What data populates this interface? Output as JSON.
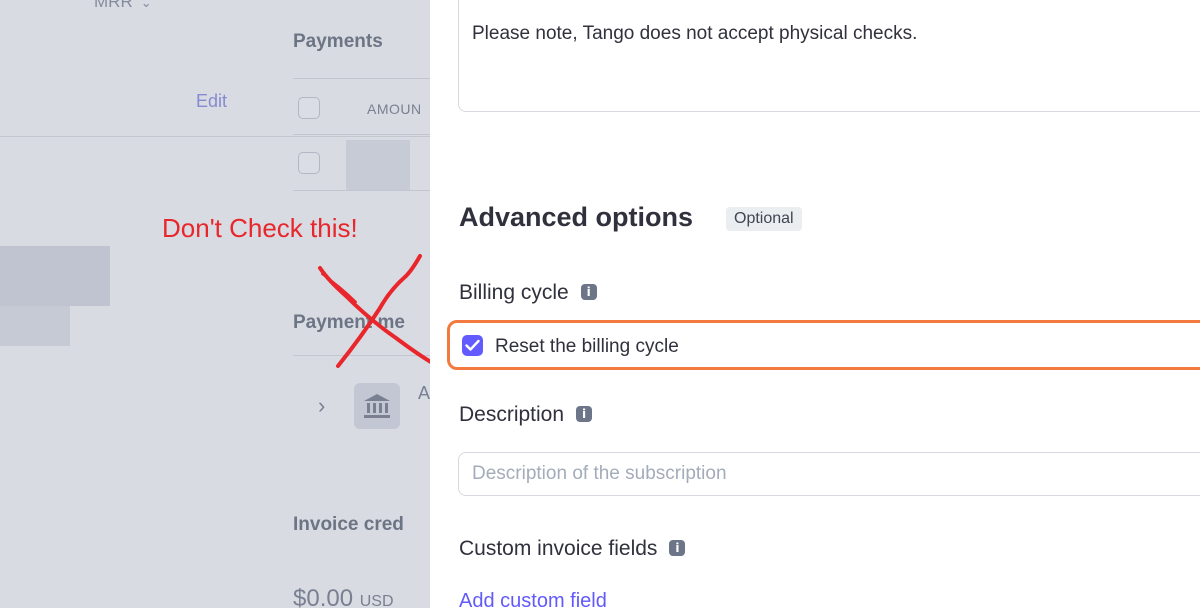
{
  "background": {
    "mrr_label": "MRR",
    "payments_heading": "Payments",
    "edit_link": "Edit",
    "amount_header": "AMOUN",
    "payment_methods_heading": "Payment me",
    "invoice_credit_heading": "Invoice cred",
    "credit_amount": "$0.00",
    "credit_currency": "USD",
    "row_initial": "A"
  },
  "annotation": {
    "text": "Don't Check this!",
    "color": "#e8262b"
  },
  "panel": {
    "notes_text": "Please note, Tango does not accept physical checks.",
    "advanced_title": "Advanced options",
    "optional_badge": "Optional",
    "billing_cycle_label": "Billing cycle",
    "reset_label": "Reset the billing cycle",
    "reset_checked": true,
    "description_label": "Description",
    "description_placeholder": "Description of the subscription",
    "custom_fields_label": "Custom invoice fields",
    "add_custom_field_link": "Add custom field"
  },
  "colors": {
    "accent": "#635bff",
    "highlight_border": "#f27a3f",
    "link": "#625afa"
  },
  "icons": [
    "chevron-down-icon",
    "info-icon",
    "checkmark-icon",
    "bank-icon",
    "chevron-right-icon"
  ]
}
